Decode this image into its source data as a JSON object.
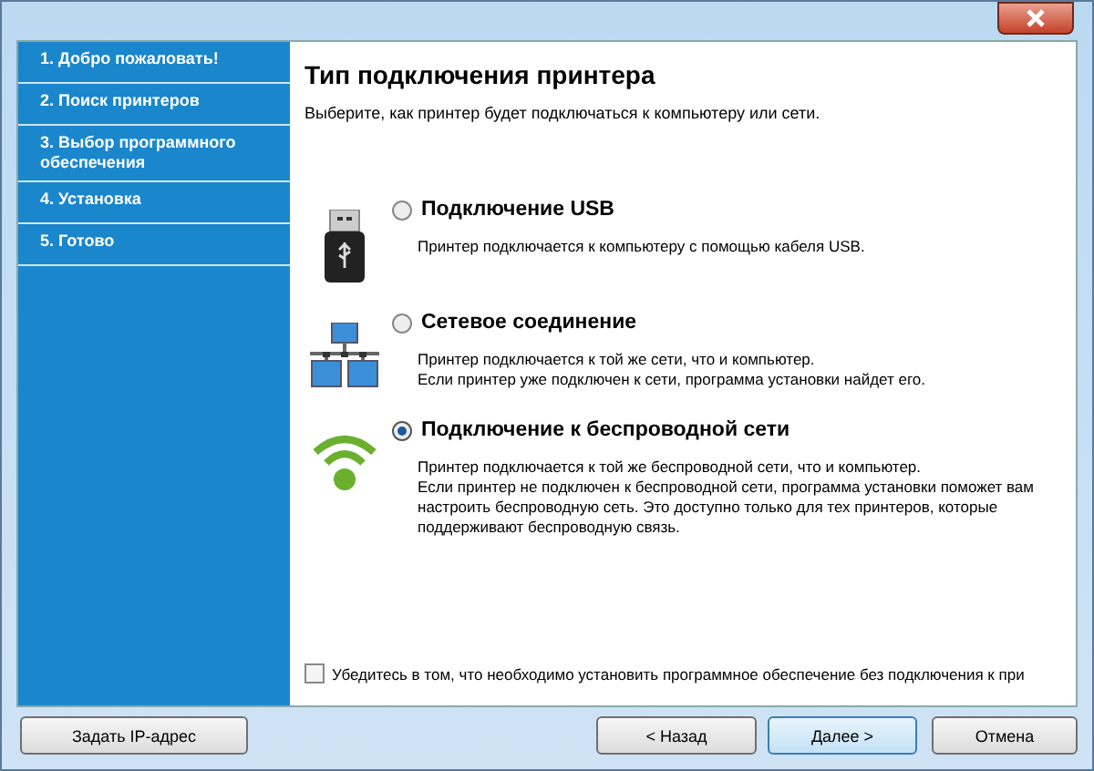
{
  "steps": [
    {
      "label": "1. Добро пожаловать!"
    },
    {
      "label": "2. Поиск принтеров"
    },
    {
      "label": "3. Выбор программного обеспечения"
    },
    {
      "label": "4. Установка"
    },
    {
      "label": "5. Готово"
    }
  ],
  "heading": "Тип подключения принтера",
  "intro": "Выберите, как принтер будет подключаться к компьютеру или сети.",
  "options": [
    {
      "kind": "usb",
      "label": "Подключение USB",
      "selected": false,
      "lines": [
        "Принтер подключается к компьютеру с помощью кабеля USB."
      ]
    },
    {
      "kind": "network",
      "label": "Сетевое соединение",
      "selected": false,
      "lines": [
        "Принтер подключается к той же сети, что и компьютер.",
        "Если принтер уже подключен к сети, программа установки найдет его."
      ]
    },
    {
      "kind": "wireless",
      "label": "Подключение к беспроводной сети",
      "selected": true,
      "lines": [
        "Принтер подключается к той же беспроводной сети, что и компьютер.",
        "Если принтер не подключен к беспроводной сети, программа установки поможет вам настроить беспроводную сеть. Это доступно только для тех принтеров, которые поддерживают беспроводную связь."
      ]
    }
  ],
  "no_connection": {
    "label": "Убедитесь в том, что необходимо установить программное обеспечение без подключения к при",
    "checked": false
  },
  "buttons": {
    "left": "Задать IP-адрес",
    "back": "< Назад",
    "next": "Далее >",
    "cancel": "Отмена"
  }
}
